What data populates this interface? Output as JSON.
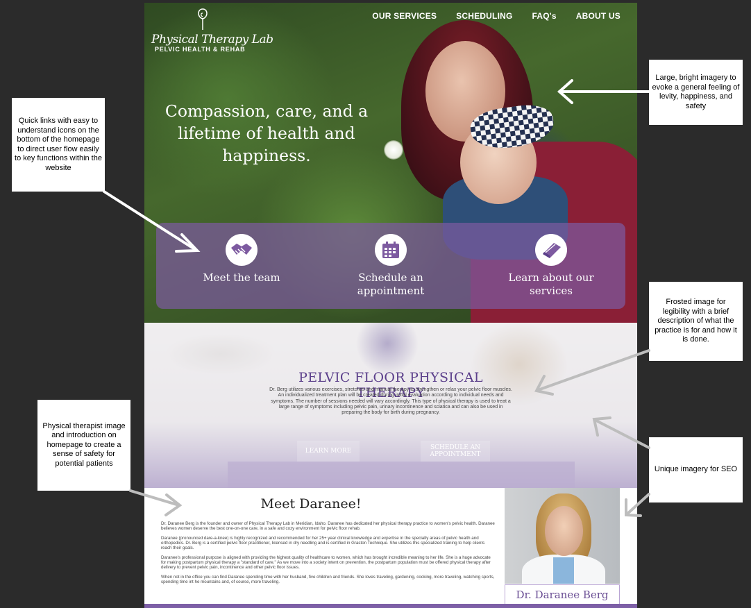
{
  "site": {
    "logo": {
      "script": "Physical Therapy Lab",
      "subtitle": "PELVIC HEALTH & REHAB"
    },
    "nav": [
      "OUR SERVICES",
      "SCHEDULING",
      "FAQ's",
      "ABOUT US"
    ],
    "hero": {
      "headline": "Compassion, care, and a lifetime of health and happiness."
    },
    "quick_links": [
      {
        "label": "Meet the team",
        "icon": "handshake-icon"
      },
      {
        "label": "Schedule an appointment",
        "icon": "calendar-icon"
      },
      {
        "label": "Learn about our services",
        "icon": "book-icon"
      }
    ],
    "therapy": {
      "title": "PELVIC FLOOR PHYSICAL THERAPY",
      "body": "Dr. Berg utilizes various exercises, stretches and manual therapy to strengthen or relax your pelvic floor muscles. An individualized treatment plan will be created during initial evaluation according to individual needs and symptoms. The number of sessions needed will vary accordingly. This type of physical therapy is used to treat a large range of symptoms including pelvic pain, urinary incontinence and sciatica and can also be used in preparing the body for birth during pregnancy.",
      "buttons": [
        "LEARN MORE",
        "SCHEDULE AN APPOINTMENT"
      ]
    },
    "meet": {
      "title": "Meet Daranee!",
      "paragraphs": [
        "Dr. Daranee Berg is the founder and owner of Physical Therapy Lab in Meridian, Idaho. Daranee has dedicated her physical therapy practice to women's pelvic health. Daranee believes women deserve the best one-on-one care, in a safe and cozy environment for pelvic floor rehab.",
        "Daranee (pronounced dare-a-knee) is highly recognized and recommended for her 25+ year clinical knowledge and expertise in the specialty areas of pelvic health and orthopedics. Dr. Berg is a certified pelvic floor practitioner, licensed in dry needling and is certified in Graston Technique. She utilizes this specialized training to help clients reach their goals.",
        "Daranee's professional purpose is aligned with providing the highest quality of healthcare to women, which has brought incredible meaning to her life. She is a huge advocate for making postpartum physical therapy a \"standard of care.\" As we move into a society intent on prevention, the postpartum population must be offered physical therapy after delivery to prevent pelvic pain, incontinence and other pelvic floor issues.",
        "When not in the office you can find Daranee spending time with her husband, five children and friends. She loves traveling, gardening, cooking, more traveling, watching sports, spending time int he mountains and, of course, more traveling."
      ],
      "caption": "Dr. Daranee Berg"
    }
  },
  "annotations": {
    "quick_links": "Quick links with easy to understand icons on the bottom of the homepage to direct user flow easily to key functions within the website",
    "imagery": "Large, bright imagery to evoke a general feeling of levity, happiness, and safety",
    "frosted": "Frosted image for legibility with a brief description of what the practice is for and how it is done.",
    "therapist": "Physical therapist image and introduction on homepage to create a sense of safety for potential patients",
    "seo": "Unique imagery for SEO"
  },
  "colors": {
    "brand_purple": "#5b3f8b",
    "panel_purple": "#7d5aa0",
    "canvas": "#2b2b2b"
  }
}
